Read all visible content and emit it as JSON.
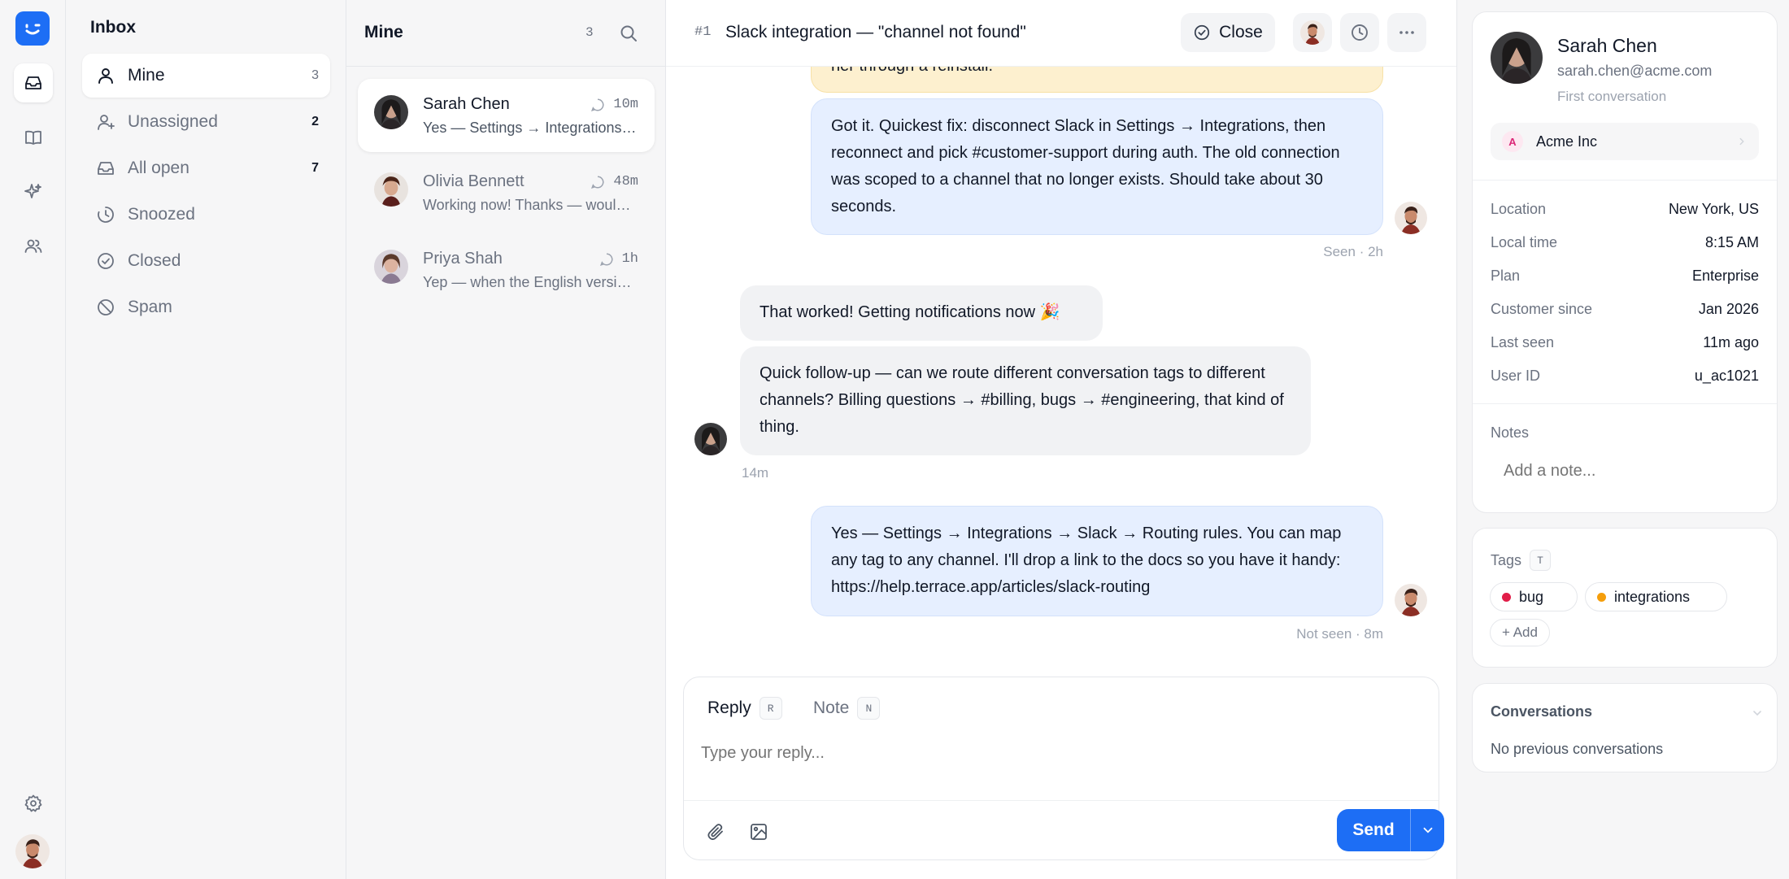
{
  "colors": {
    "accent": "#1d6ef5",
    "agent_bubble": "#e6efff",
    "customer_bubble": "#f1f2f4",
    "tag_bug": "#e11d48",
    "tag_integrations": "#f59e0b",
    "company_badge": "#db2777"
  },
  "rail": {
    "icons": [
      "logo-smile-icon",
      "inbox-icon",
      "book-icon",
      "sparkles-icon",
      "users-icon",
      "gear-icon",
      "user-avatar"
    ]
  },
  "nav": {
    "title": "Inbox",
    "items": [
      {
        "label": "Mine",
        "count": "3",
        "icon": "user-icon"
      },
      {
        "label": "Unassigned",
        "count": "2",
        "icon": "user-plus-icon"
      },
      {
        "label": "All open",
        "count": "7",
        "icon": "inbox-icon"
      },
      {
        "label": "Snoozed",
        "count": "",
        "icon": "snooze-icon"
      },
      {
        "label": "Closed",
        "count": "",
        "icon": "check-circle-icon"
      },
      {
        "label": "Spam",
        "count": "",
        "icon": "ban-icon"
      }
    ]
  },
  "list": {
    "title": "Mine",
    "count": "3",
    "conversations": [
      {
        "name": "Sarah Chen",
        "time": "10m",
        "preview": "Yes — Settings → Integrations → Slack → Routing rules. You can map any tag to any channel."
      },
      {
        "name": "Olivia Bennett",
        "time": "48m",
        "preview": "Working now! Thanks — would love to see more of this."
      },
      {
        "name": "Priya Shah",
        "time": "1h",
        "preview": "Yep — when the English version is ready, let me know."
      }
    ]
  },
  "main": {
    "conv_number": "#1",
    "title": "Slack integration — \"channel not found\"",
    "close_label": "Close",
    "messages": {
      "cut_off_text": "her through a reinstall.",
      "agent_1": "Got it. Quickest fix: disconnect Slack in Settings → Integrations, then reconnect and pick #customer-support during auth. The old connection was scoped to a channel that no longer exists. Should take about 30 seconds.",
      "agent_1_meta": "Seen · 2h",
      "customer_1": "That worked! Getting notifications now 🎉",
      "customer_2": "Quick follow-up — can we route different conversation tags to different channels? Billing questions → #billing, bugs → #engineering, that kind of thing.",
      "customer_meta": "14m",
      "agent_2": "Yes — Settings → Integrations → Slack → Routing rules. You can map any tag to any channel. I'll drop a link to the docs so you have it handy: https://help.terrace.app/articles/slack-routing",
      "agent_2_meta": "Not seen · 8m"
    },
    "composer": {
      "reply_tab": "Reply",
      "reply_key": "R",
      "note_tab": "Note",
      "note_key": "N",
      "placeholder": "Type your reply...",
      "send_label": "Send"
    }
  },
  "profile": {
    "name": "Sarah Chen",
    "email": "sarah.chen@acme.com",
    "first_conversation": "First conversation",
    "company": {
      "initial": "A",
      "name": "Acme Inc"
    },
    "attributes": [
      {
        "key": "Location",
        "value": "New York, US"
      },
      {
        "key": "Local time",
        "value": "8:15 AM"
      },
      {
        "key": "Plan",
        "value": "Enterprise"
      },
      {
        "key": "Customer since",
        "value": "Jan 2026"
      },
      {
        "key": "Last seen",
        "value": "11m ago"
      },
      {
        "key": "User ID",
        "value": "u_ac1021"
      }
    ],
    "notes_label": "Notes",
    "notes_placeholder": "Add a note...",
    "tags_label": "Tags",
    "tags_key": "T",
    "tags": [
      {
        "label": "bug"
      },
      {
        "label": "integrations"
      }
    ],
    "add_tag_label": "+ Add",
    "conversations_label": "Conversations",
    "no_conversations": "No previous conversations"
  }
}
